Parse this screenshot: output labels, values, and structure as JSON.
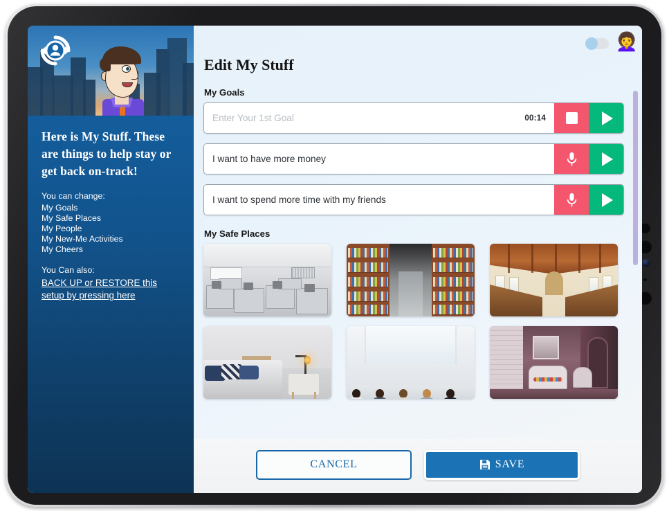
{
  "app": {
    "logo_icon": "account-refresh-icon"
  },
  "sidebar": {
    "headline": "Here is My Stuff. These are things to help stay or get back on-track!",
    "change_label": "You can change:",
    "change_items": [
      "My Goals",
      "My Safe Places",
      "My People",
      "My New-Me Activities",
      "My Cheers"
    ],
    "also_label": "You Can also:",
    "backup_link": "BACK UP or RESTORE this setup by pressing here"
  },
  "header": {
    "title": "Edit My Stuff",
    "toggle_state": "off",
    "avatar_emoji": "👩‍🦱",
    "avatar_name": "deaf-woman-emoji"
  },
  "goals": {
    "section_label": "My Goals",
    "rows": [
      {
        "value": "",
        "placeholder": "Enter Your 1st Goal",
        "timer": "00:14",
        "record_state": "recording",
        "record_icon": "stop-icon",
        "play_icon": "play-icon"
      },
      {
        "value": "I want to have more money",
        "placeholder": "",
        "timer": "",
        "record_state": "idle",
        "record_icon": "microphone-icon",
        "play_icon": "play-icon"
      },
      {
        "value": "I want to spend more time with my friends",
        "placeholder": "",
        "timer": "",
        "record_state": "idle",
        "record_icon": "microphone-icon",
        "play_icon": "play-icon"
      }
    ]
  },
  "safe_places": {
    "section_label": "My Safe Places",
    "thumbs": [
      {
        "name": "office-cubicles",
        "alt": "Office with cubicles and monitors"
      },
      {
        "name": "library-aisle",
        "alt": "Library book shelves aisle"
      },
      {
        "name": "church-interior",
        "alt": "Church interior with wooden pews"
      },
      {
        "name": "bedroom",
        "alt": "Bedroom with bed and nightstand lamp"
      },
      {
        "name": "support-group",
        "alt": "Support group sitting in a circle"
      },
      {
        "name": "porch",
        "alt": "Porch with wicker settee and chair"
      }
    ]
  },
  "footer": {
    "cancel_label": "CANCEL",
    "save_label": "SAVE",
    "save_icon": "floppy-disk-icon"
  },
  "colors": {
    "record_red": "#f4566e",
    "play_green": "#05b87b",
    "primary_blue": "#1b72b4",
    "sidebar_blue": "#12538c",
    "scrollbar": "#bcb0dc"
  }
}
